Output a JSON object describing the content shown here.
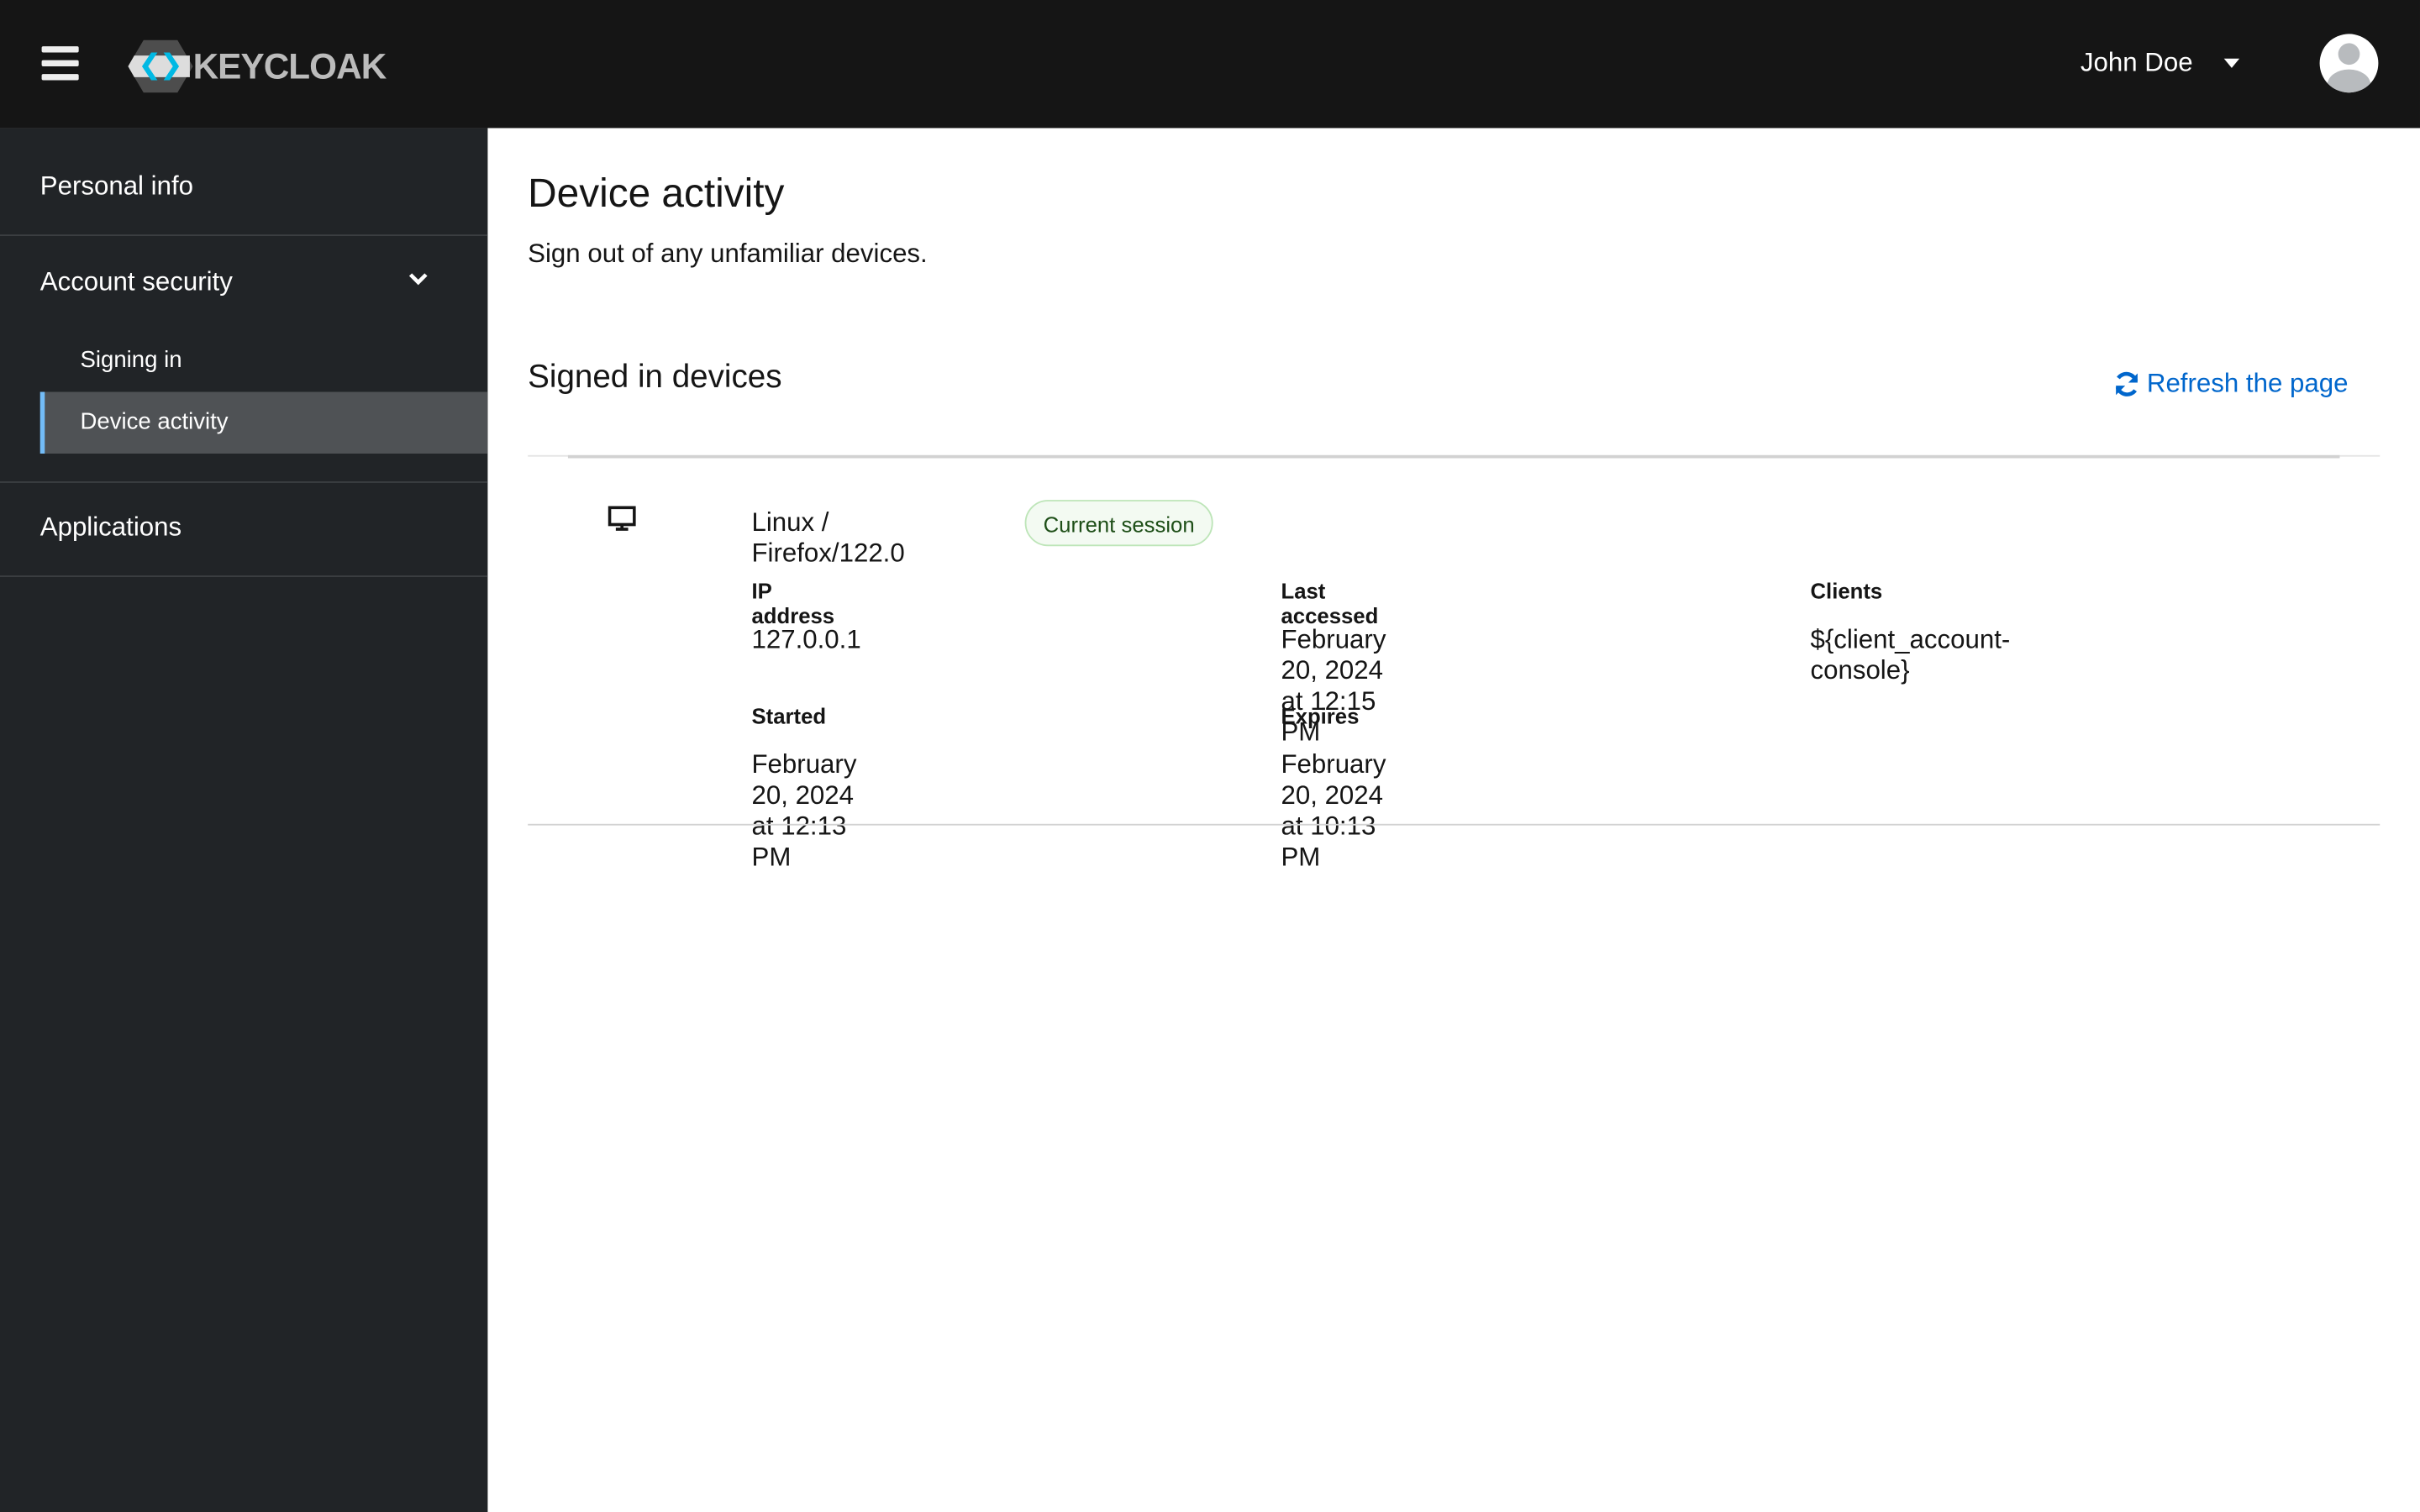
{
  "header": {
    "brand": "KEYCLOAK",
    "user_name": "John Doe"
  },
  "sidebar": {
    "items": [
      {
        "label": "Personal info"
      },
      {
        "label": "Account security"
      },
      {
        "label": "Signing in"
      },
      {
        "label": "Device activity"
      },
      {
        "label": "Applications"
      }
    ]
  },
  "main": {
    "title": "Device activity",
    "subtitle": "Sign out of any unfamiliar devices.",
    "section_title": "Signed in devices",
    "refresh_label": "Refresh the page",
    "device": {
      "name": "Linux / Firefox/122.0",
      "badge": "Current session",
      "fields": [
        {
          "label": "IP address",
          "value": "127.0.0.1"
        },
        {
          "label": "Last accessed",
          "value": "February 20, 2024 at 12:15 PM"
        },
        {
          "label": "Clients",
          "value": "${client_account-console}"
        },
        {
          "label": "Started",
          "value": "February 20, 2024 at 12:13 PM"
        },
        {
          "label": "Expires",
          "value": "February 20, 2024 at 10:13 PM"
        }
      ]
    }
  },
  "colors": {
    "link": "#0066cc",
    "badge_text": "#1e4f18",
    "badge_bg": "#f3faf2",
    "badge_border": "#bde5b8",
    "active_border": "#73bcf7"
  }
}
